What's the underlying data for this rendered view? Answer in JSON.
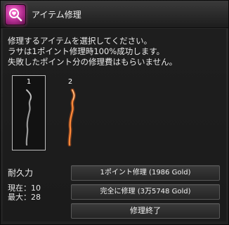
{
  "window": {
    "title": "アイテム修理"
  },
  "description": {
    "line1": "修理するアイテムを選択してください。",
    "line2": "ラサは1ポイント修理時100%成功します。",
    "line3": "失敗したポイント分の修理費はもらいません。"
  },
  "items": [
    {
      "slot": "1",
      "icon": "gray-staff-icon",
      "selected": true
    },
    {
      "slot": "2",
      "icon": "glowing-orange-staff-icon",
      "selected": false
    }
  ],
  "durability": {
    "label": "耐久力",
    "current_text": "現在：10",
    "max_text": "最大：28"
  },
  "buttons": {
    "repair_one": "1ポイント修理 (1986 Gold)",
    "repair_full": "完全に修理 (3万5748 Gold)",
    "close": "修理終了"
  },
  "colors": {
    "accent": "#d63fae",
    "glow": "#ff7a2e"
  }
}
